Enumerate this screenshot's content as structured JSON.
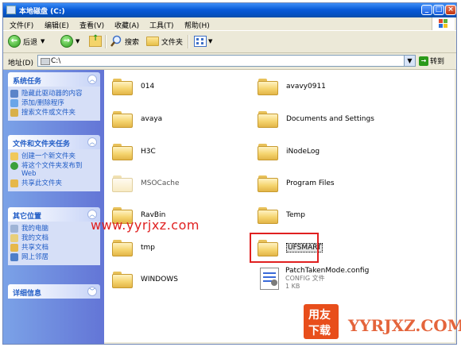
{
  "window": {
    "title": "本地磁盘 (C:)",
    "buttons": {
      "minimize": "_",
      "maximize": "□",
      "close": "×"
    }
  },
  "menu": [
    "文件(F)",
    "编辑(E)",
    "查看(V)",
    "收藏(A)",
    "工具(T)",
    "帮助(H)"
  ],
  "toolbar": {
    "back_label": "后退",
    "search_label": "搜索",
    "folders_label": "文件夹"
  },
  "address": {
    "label": "地址(D)",
    "value": "C:\\",
    "go_label": "转到"
  },
  "taskpane": {
    "system": {
      "title": "系统任务",
      "items": [
        "隐藏此驱动器的内容",
        "添加/删除程序",
        "搜索文件或文件夹"
      ]
    },
    "file_folder": {
      "title": "文件和文件夹任务",
      "items": [
        "创建一个新文件夹",
        "将这个文件夹发布到 Web",
        "共享此文件夹"
      ]
    },
    "other_places": {
      "title": "其它位置",
      "items": [
        "我的电脑",
        "我的文档",
        "共享文档",
        "网上邻居"
      ]
    },
    "details": {
      "title": "详细信息"
    }
  },
  "files": [
    {
      "name": "014"
    },
    {
      "name": "avavy0911"
    },
    {
      "name": "avaya"
    },
    {
      "name": "Documents and Settings"
    },
    {
      "name": "H3C"
    },
    {
      "name": "iNodeLog"
    },
    {
      "name": "MSOCache"
    },
    {
      "name": "Program Files"
    },
    {
      "name": "RavBin"
    },
    {
      "name": "Temp"
    },
    {
      "name": "tmp"
    },
    {
      "name": "UFSMART"
    },
    {
      "name": "WINDOWS"
    },
    {
      "name": "PatchTakenMode.config",
      "type": "CONFIG 文件",
      "size": "1 KB"
    }
  ],
  "watermarks": {
    "site": "www.yyrjxz.com",
    "logo_top": "用友",
    "logo_bottom": "下载",
    "brand": "YYRJXZ.COM"
  }
}
